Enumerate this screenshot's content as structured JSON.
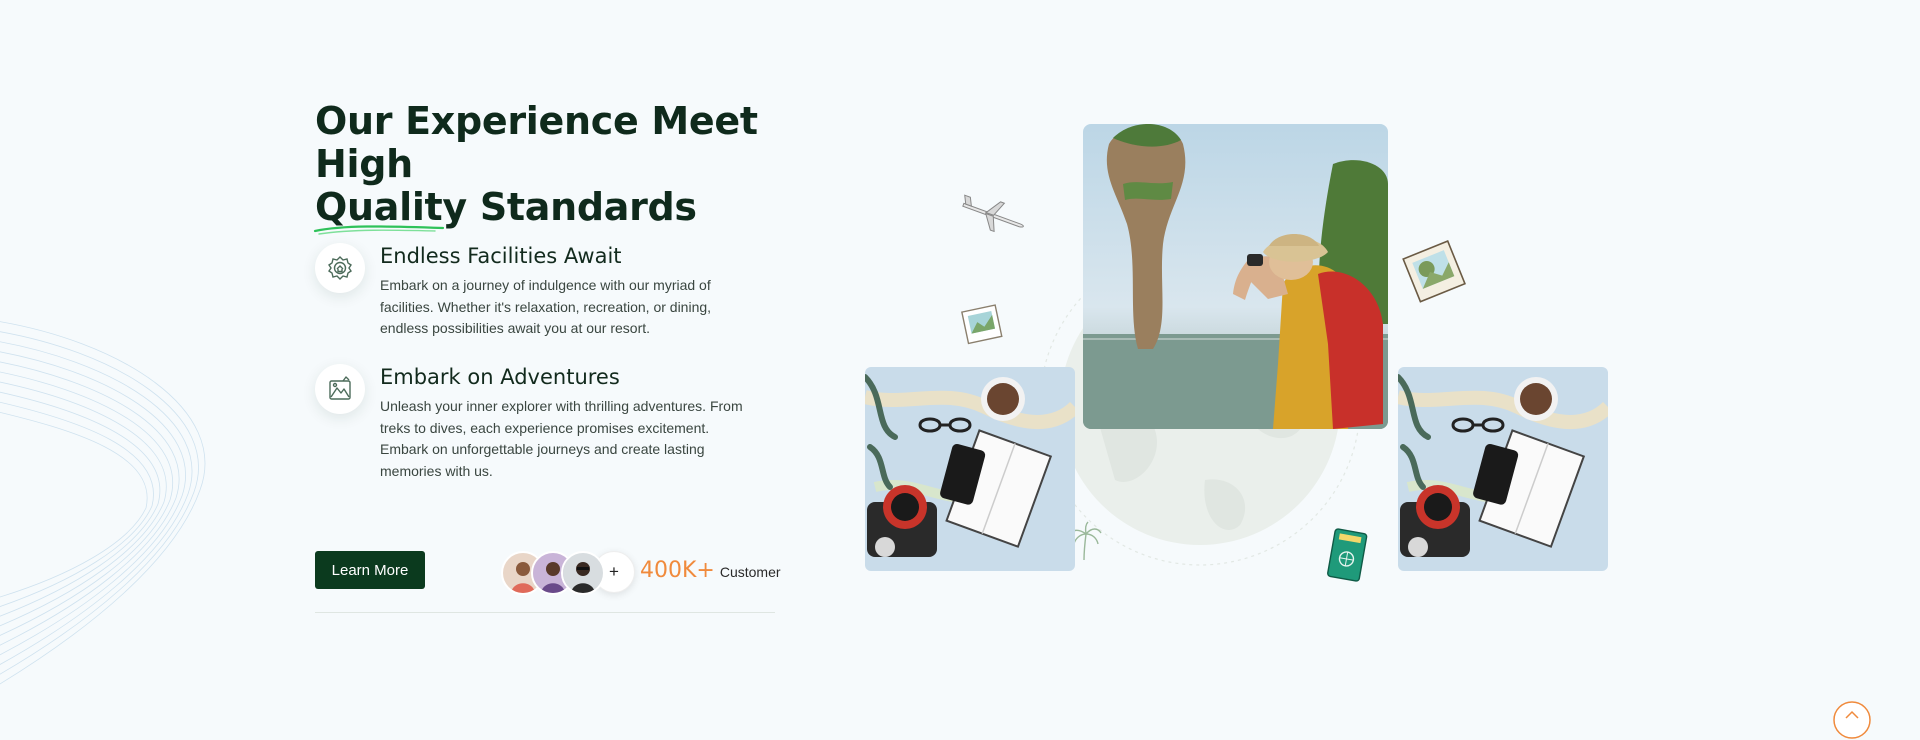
{
  "section": {
    "heading_line1": "Our Experience Meet High",
    "heading_highlight": "Quality",
    "heading_rest": " Standards"
  },
  "features": [
    {
      "title": "Endless Facilities Await",
      "description": "Embark on a journey of indulgence with our myriad of facilities. Whether it's relaxation, recreation, or dining, endless possibilities await you at our resort.",
      "icon": "resort-facilities-icon"
    },
    {
      "title": "Embark on Adventures",
      "description": "Unleash your inner explorer with thrilling adventures. From treks to dives, each experience promises excitement. Embark on unforgettable journeys and create lasting memories with us.",
      "icon": "mountain-adventure-icon"
    }
  ],
  "cta": {
    "label": "Learn More"
  },
  "customers": {
    "plus": "+",
    "count": "400K+",
    "label": "Customer"
  },
  "colors": {
    "primary": "#0b3a1e",
    "accent": "#f08a3c",
    "highlight_stroke": "#2fc25a",
    "background": "#f6fafc"
  }
}
